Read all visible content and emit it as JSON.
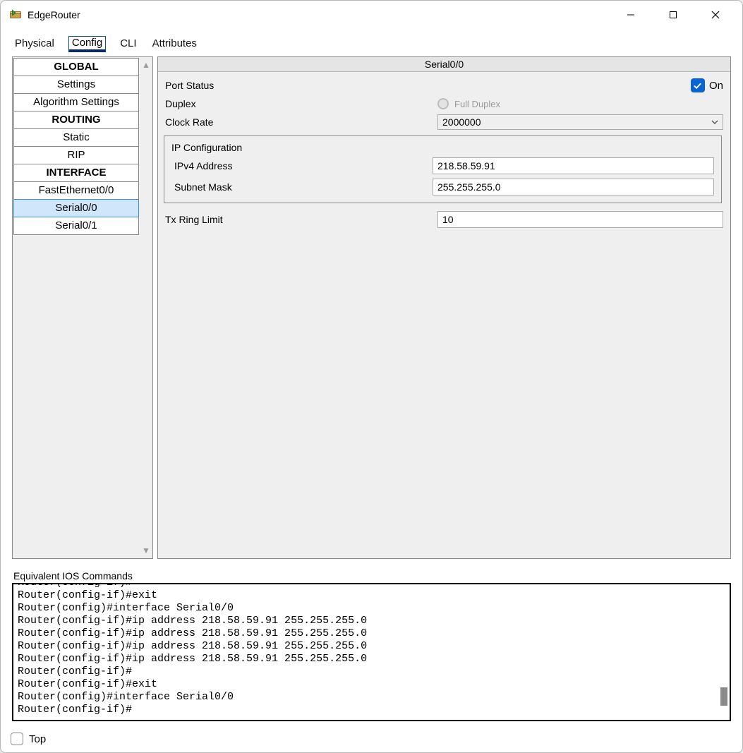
{
  "window": {
    "title": "EdgeRouter"
  },
  "tabs": [
    "Physical",
    "Config",
    "CLI",
    "Attributes"
  ],
  "active_tab": "Config",
  "sidebar": {
    "sections": [
      {
        "header": "GLOBAL",
        "items": [
          "Settings",
          "Algorithm Settings"
        ]
      },
      {
        "header": "ROUTING",
        "items": [
          "Static",
          "RIP"
        ]
      },
      {
        "header": "INTERFACE",
        "items": [
          "FastEthernet0/0",
          "Serial0/0",
          "Serial0/1"
        ]
      }
    ],
    "selected": "Serial0/0"
  },
  "panel": {
    "title": "Serial0/0",
    "port_status_label": "Port Status",
    "port_status_on": "On",
    "duplex_label": "Duplex",
    "duplex_value": "Full Duplex",
    "clock_rate_label": "Clock Rate",
    "clock_rate_value": "2000000",
    "ip_config_label": "IP Configuration",
    "ipv4_label": "IPv4 Address",
    "ipv4_value": "218.58.59.91",
    "subnet_label": "Subnet Mask",
    "subnet_value": "255.255.255.0",
    "tx_ring_label": "Tx Ring Limit",
    "tx_ring_value": "10"
  },
  "ios": {
    "label": "Equivalent IOS Commands",
    "lines": [
      "Router(config-if)#",
      "Router(config-if)#exit",
      "Router(config)#interface Serial0/0",
      "Router(config-if)#ip address 218.58.59.91 255.255.255.0",
      "Router(config-if)#ip address 218.58.59.91 255.255.255.0",
      "Router(config-if)#ip address 218.58.59.91 255.255.255.0",
      "Router(config-if)#ip address 218.58.59.91 255.255.255.0",
      "Router(config-if)#",
      "Router(config-if)#exit",
      "Router(config)#interface Serial0/0",
      "Router(config-if)#"
    ]
  },
  "footer": {
    "top_label": "Top"
  }
}
